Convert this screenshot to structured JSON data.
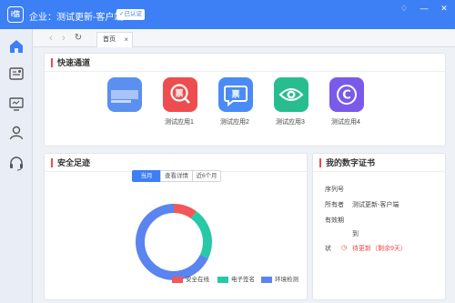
{
  "titlebar": {
    "logo_text": "i信",
    "title": "企业：测试更新-客户端",
    "badge": "已认证",
    "buttons": [
      "♢",
      "—",
      "✕"
    ]
  },
  "sidebar": {
    "items": [
      {
        "name": "home-icon",
        "active": true
      },
      {
        "name": "certificate-icon",
        "active": false
      },
      {
        "name": "monitor-icon",
        "active": false
      },
      {
        "name": "user-icon",
        "active": false
      },
      {
        "name": "headset-icon",
        "active": false
      }
    ]
  },
  "tabbar": {
    "back": "‹",
    "forward": "›",
    "refresh": "↻",
    "tab_label": "首页",
    "tab_close": "×"
  },
  "quick_access": {
    "title": "快速通道",
    "apps": [
      {
        "label": "",
        "glyph": "",
        "color": "#5b8ff0"
      },
      {
        "label": "测试应用1",
        "glyph": "票",
        "color": "#ee4d4f"
      },
      {
        "label": "测试应用2",
        "glyph": "票",
        "color": "#4a8bf5"
      },
      {
        "label": "测试应用3",
        "glyph": "◉",
        "color": "#27bd8f"
      },
      {
        "label": "测试应用4",
        "glyph": "C",
        "color": "#7a5ae8"
      }
    ]
  },
  "security": {
    "title": "安全足迹",
    "segments": [
      "当月",
      "查看详情",
      "近6个月"
    ],
    "legend": [
      "安全在线",
      "电子签名",
      "环境检测"
    ],
    "colors": {
      "red": "#f2575a",
      "green": "#27c9a6",
      "blue": "#5a84f0"
    }
  },
  "chart_data": {
    "type": "pie",
    "labels": [
      "安全在线",
      "电子签名",
      "环境检测"
    ],
    "values": [
      10,
      22,
      68
    ],
    "colors": [
      "#f2575a",
      "#27c9a6",
      "#5a84f0"
    ]
  },
  "certificate": {
    "title": "我的数字证书",
    "rows": [
      {
        "label": "序列号",
        "value": ""
      },
      {
        "label": "所有者",
        "value": "测试更新-客户端"
      },
      {
        "label": "有效期",
        "value": ""
      },
      {
        "label": "",
        "value": "到"
      },
      {
        "label": "状",
        "value": "待更新（剩余9天）"
      }
    ]
  }
}
